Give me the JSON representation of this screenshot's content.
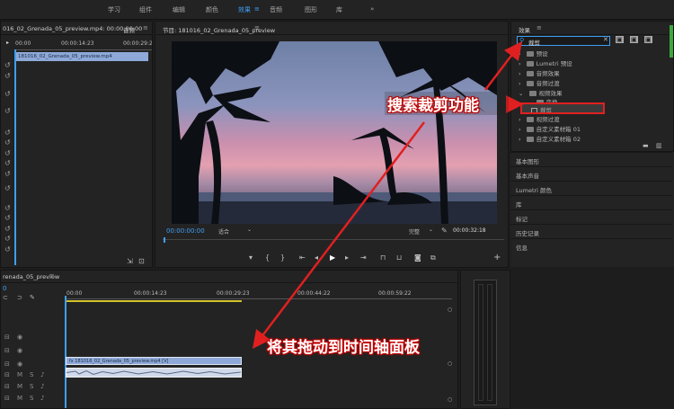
{
  "workspaces": {
    "items": [
      "学习",
      "组件",
      "编辑",
      "颜色",
      "效果",
      "音频",
      "图形",
      "库"
    ],
    "active": "效果",
    "more": "»"
  },
  "source_panel": {
    "title": "016_02_Grenada_05_preview.mp4: 00:00:00:00",
    "tab2": "音频",
    "time_start": "00:00",
    "time_mid": "00:00:14:23",
    "time_end": "00:00:29:2",
    "clip_name": "181016_02_Grenada_05_preview.mp4"
  },
  "program_panel": {
    "title": "节目: 181016_02_Grenada_05_preview",
    "timecode": "00:00:00:00",
    "fit": "适合",
    "quality": "完整",
    "duration": "00:00:32:18"
  },
  "effects_panel": {
    "title": "效果",
    "search_value": "裁剪",
    "tree": [
      {
        "label": "预设"
      },
      {
        "label": "Lumetri 预设"
      },
      {
        "label": "音频效果"
      },
      {
        "label": "音频过渡"
      },
      {
        "label": "视频效果"
      },
      {
        "label": "变换"
      },
      {
        "label": "裁剪"
      },
      {
        "label": "视频过渡"
      },
      {
        "label": "自定义素材箱 01"
      },
      {
        "label": "自定义素材箱 02"
      }
    ]
  },
  "side_sections": [
    "基本图形",
    "基本声音",
    "Lumetri 颜色",
    "库",
    "标记",
    "历史记录",
    "信息"
  ],
  "timeline": {
    "title": "renada_05_preview",
    "timecode": "0",
    "ruler": [
      "00:00",
      "00:00:14:23",
      "00:00:29:23",
      "00:00:44:22",
      "00:00:59:22"
    ],
    "video_clip": "fx 181016_02_Grenada_05_preview.mp4 [V]"
  },
  "annotations": {
    "search": "搜索裁剪功能",
    "drag": "将其拖动到时间轴面板"
  },
  "colors": {
    "accent": "#3e9ff4",
    "annotation_red": "#e02020",
    "video_clip": "#8ea9d8",
    "audio_clip": "#cfd9ea"
  }
}
